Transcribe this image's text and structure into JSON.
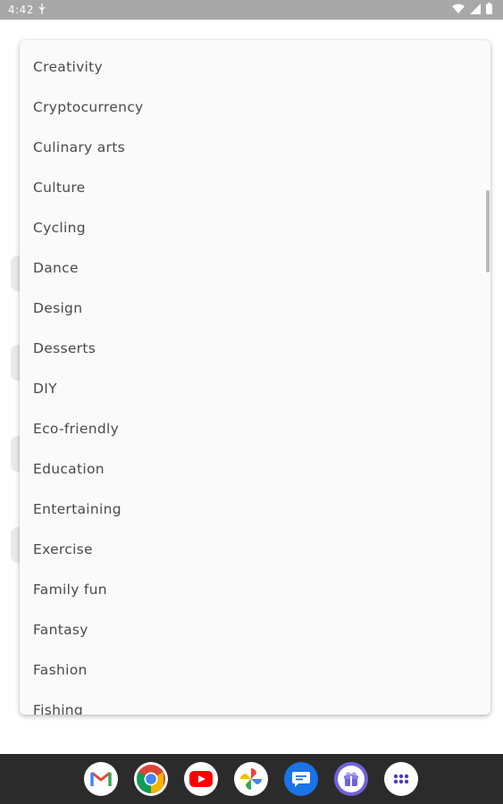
{
  "status_bar": {
    "time": "4:42",
    "usb_icon": "usb-icon",
    "wifi_icon": "wifi-icon",
    "signal_icon": "signal-icon",
    "battery_icon": "battery-icon"
  },
  "dropdown": {
    "items": [
      "Creativity",
      "Cryptocurrency",
      "Culinary arts",
      "Culture",
      "Cycling",
      "Dance",
      "Design",
      "Desserts",
      "DIY",
      "Eco-friendly",
      "Education",
      "Entertaining",
      "Exercise",
      "Family fun",
      "Fantasy",
      "Fashion",
      "Fishing"
    ]
  },
  "dock": {
    "apps": [
      "gmail-icon",
      "chrome-icon",
      "youtube-icon",
      "photos-icon",
      "messages-icon",
      "gift-icon",
      "app-drawer-icon"
    ]
  },
  "colors": {
    "status_bar": "#a8a8a8",
    "list_background": "#fafafa",
    "list_text": "#4a4a4a",
    "nav_bar": "#2b2b2b"
  }
}
